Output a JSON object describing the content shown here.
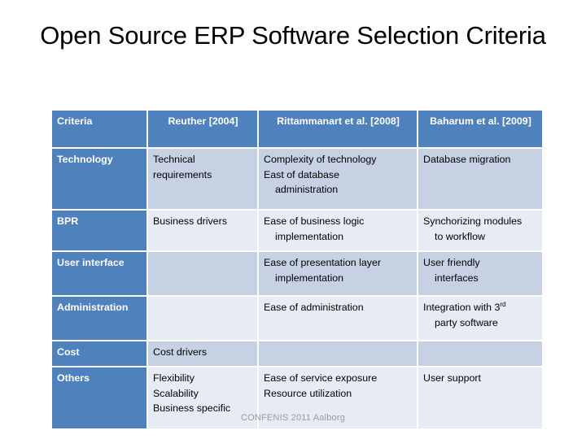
{
  "slide": {
    "title": "Open Source ERP Software Selection Criteria",
    "footer": "CONFENIS 2011 Aalborg"
  },
  "colors": {
    "header_blue": "#4f81bd",
    "band_dark": "#c6d1e4",
    "band_light": "#e7ecf4",
    "footer_text": "#9a9a9a"
  },
  "table": {
    "headers": [
      "Criteria",
      "Reuther [2004]",
      "Rittammanart et al. [2008]",
      "Baharum et al. [2009]"
    ],
    "rows": [
      {
        "criteria": "Technology",
        "reuther": [
          "Technical",
          "requirements"
        ],
        "rittammanart": [
          "Complexity of technology",
          "East of database",
          "administration"
        ],
        "baharum": [
          "Database migration"
        ]
      },
      {
        "criteria": "BPR",
        "reuther": [
          "Business drivers"
        ],
        "rittammanart": [
          "Ease of business logic",
          "implementation"
        ],
        "baharum": [
          "Synchorizing modules",
          "to workflow"
        ]
      },
      {
        "criteria": "User interface",
        "reuther": [],
        "rittammanart": [
          "Ease of presentation layer",
          "implementation"
        ],
        "baharum": [
          "User friendly",
          "interfaces"
        ]
      },
      {
        "criteria": "Administration",
        "reuther": [],
        "rittammanart": [
          "Ease of administration"
        ],
        "baharum": [
          "Integration with 3rd",
          "party software"
        ]
      },
      {
        "criteria": "Cost",
        "reuther": [
          "Cost drivers"
        ],
        "rittammanart": [],
        "baharum": []
      },
      {
        "criteria": "Others",
        "reuther": [
          "Flexibility",
          "Scalability",
          "Business specific"
        ],
        "rittammanart": [
          "Ease of service exposure",
          "Resource utilization"
        ],
        "baharum": [
          "User support"
        ]
      }
    ]
  }
}
